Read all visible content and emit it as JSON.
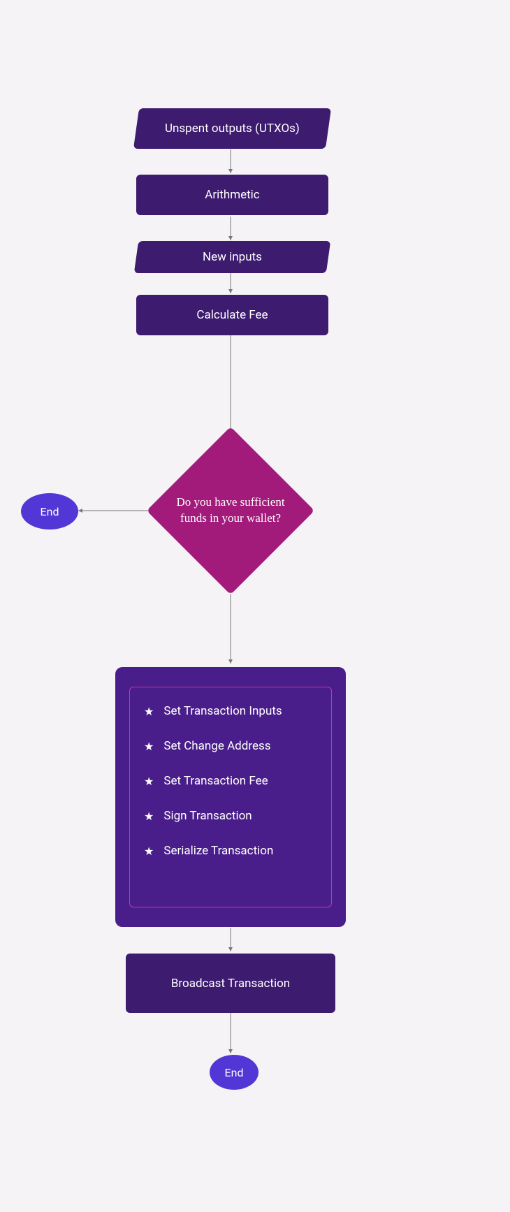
{
  "nodes": {
    "n1": "Unspent outputs (UTXOs)",
    "n2": "Arithmetic",
    "n3": "New inputs",
    "n4": "Calculate Fee",
    "decision": "Do you have sufficient funds in your wallet?",
    "end1": "End",
    "steps": [
      "Set Transaction Inputs",
      "Set Change Address",
      "Set Transaction Fee",
      "Sign Transaction",
      "Serialize Transaction"
    ],
    "n5": "Broadcast Transaction",
    "end2": "End"
  }
}
